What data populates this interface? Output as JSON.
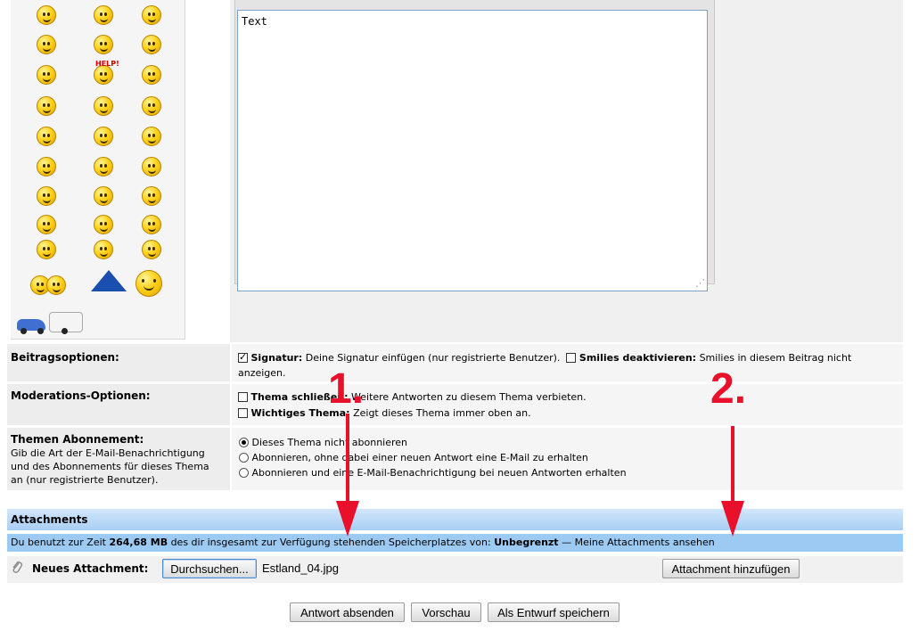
{
  "editor": {
    "textarea_value": "Text"
  },
  "options": {
    "beitragsoptionen": {
      "label": "Beitragsoptionen:",
      "signatur_label": "Signatur:",
      "signatur_desc": "Deine Signatur einfügen (nur registrierte Benutzer).",
      "smilies_label": "Smilies deaktivieren:",
      "smilies_desc_1": "Smilies in diesem Beitrag nicht",
      "smilies_desc_2": "anzeigen."
    },
    "moderation": {
      "label": "Moderations-Optionen:",
      "close_label": "Thema schließen:",
      "close_desc": "Weitere Antworten zu diesem Thema verbieten.",
      "sticky_label": "Wichtiges Thema:",
      "sticky_desc": "Zeigt dieses Thema immer oben an."
    },
    "abonnement": {
      "label": "Themen Abonnement:",
      "desc_1": "Gib die Art der E-Mail-Benachrichtigung",
      "desc_2": "und des Abonnements für dieses Thema",
      "desc_3": "an (nur registrierte Benutzer).",
      "opt_1": "Dieses Thema nicht abonnieren",
      "opt_2": "Abonnieren, ohne dabei einer neuen Antwort eine E-Mail zu erhalten",
      "opt_3": "Abonnieren und eine E-Mail-Benachrichtigung bei neuen Antworten erhalten"
    }
  },
  "attachments": {
    "title": "Attachments",
    "info_prefix": "Du benutzt zur Zeit",
    "used": "264,68 MB",
    "info_mid": "des dir insgesamt zur Verfügung stehenden Speicherplatzes von:",
    "quota": "Unbegrenzt",
    "info_dash": "—",
    "view_link": "Meine Attachments ansehen",
    "new_label": "Neues Attachment:",
    "browse_button": "Durchsuchen...",
    "file_name": "Estland_04.jpg",
    "add_button": "Attachment hinzufügen"
  },
  "actions": {
    "submit": "Antwort absenden",
    "preview": "Vorschau",
    "draft": "Als Entwurf speichern"
  },
  "smilies": {
    "help_text": "HELP!"
  },
  "annotations": {
    "step1": "1.",
    "step2": "2.",
    "color": "#e8102a"
  }
}
